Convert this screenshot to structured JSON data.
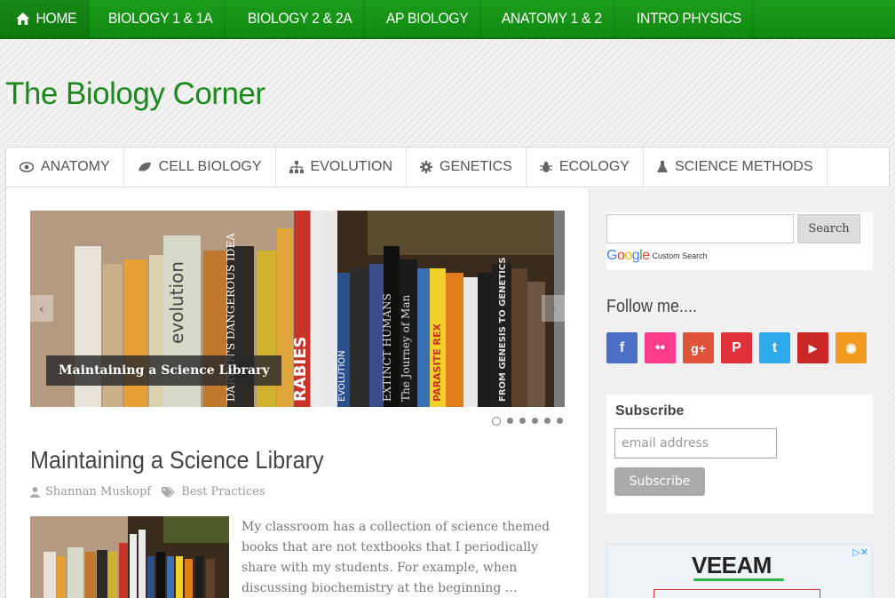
{
  "top_nav": {
    "items": [
      {
        "label": "HOME",
        "icon": "home-icon"
      },
      {
        "label": "BIOLOGY 1 & 1A"
      },
      {
        "label": "BIOLOGY 2 & 2A"
      },
      {
        "label": "AP BIOLOGY"
      },
      {
        "label": "ANATOMY 1 & 2"
      },
      {
        "label": "INTRO PHYSICS"
      }
    ]
  },
  "site": {
    "title": "The Biology Corner"
  },
  "category_nav": {
    "items": [
      {
        "label": "ANATOMY",
        "icon": "eye-icon"
      },
      {
        "label": "CELL BIOLOGY",
        "icon": "leaf-icon"
      },
      {
        "label": "EVOLUTION",
        "icon": "sitemap-icon"
      },
      {
        "label": "GENETICS",
        "icon": "gear-icon"
      },
      {
        "label": "ECOLOGY",
        "icon": "bug-icon"
      },
      {
        "label": "SCIENCE METHODS",
        "icon": "flask-icon"
      }
    ]
  },
  "slider": {
    "caption": "Maintaining a Science Library",
    "dot_count": 6,
    "active_dot": 1,
    "book_titles": [
      "evolution",
      "DARWIN'S DANGEROUS IDEA",
      "RABIES",
      "EVOLUTION",
      "EXTINCT HUMANS",
      "The Journey of Man",
      "PARASITE REX",
      "FROM GENESIS TO GENETICS"
    ]
  },
  "post": {
    "title": "Maintaining a Science Library",
    "author": "Shannan Muskopf",
    "category": "Best Practices",
    "excerpt": "My classroom has a collection of science themed books that are not textbooks that I periodically share with my students.   For example, when discussing biochemistry at the beginning …"
  },
  "sidebar": {
    "search": {
      "placeholder": "",
      "button_label": "Search",
      "brand_sub": "Custom Search",
      "brand": [
        "G",
        "o",
        "o",
        "g",
        "l",
        "e"
      ]
    },
    "follow": {
      "title": "Follow me....",
      "networks": [
        {
          "name": "facebook-icon",
          "glyph": "f",
          "color": "#4a6fc5"
        },
        {
          "name": "flickr-icon",
          "glyph": "••",
          "color": "#ff3d8a"
        },
        {
          "name": "google-plus-icon",
          "glyph": "g+",
          "color": "#e0533b"
        },
        {
          "name": "pinterest-icon",
          "glyph": "P",
          "color": "#e0303b"
        },
        {
          "name": "twitter-icon",
          "glyph": "t",
          "color": "#2ea9ea"
        },
        {
          "name": "youtube-icon",
          "glyph": "▶",
          "color": "#c92626"
        },
        {
          "name": "rss-icon",
          "glyph": "◉",
          "color": "#f39b1e"
        }
      ]
    },
    "subscribe": {
      "title": "Subscribe",
      "placeholder": "email address",
      "button_label": "Subscribe"
    },
    "ad": {
      "brand": "VEEAM"
    }
  },
  "colors": {
    "brand_green": "#1a8a1a",
    "nav_green": "#16941a"
  }
}
